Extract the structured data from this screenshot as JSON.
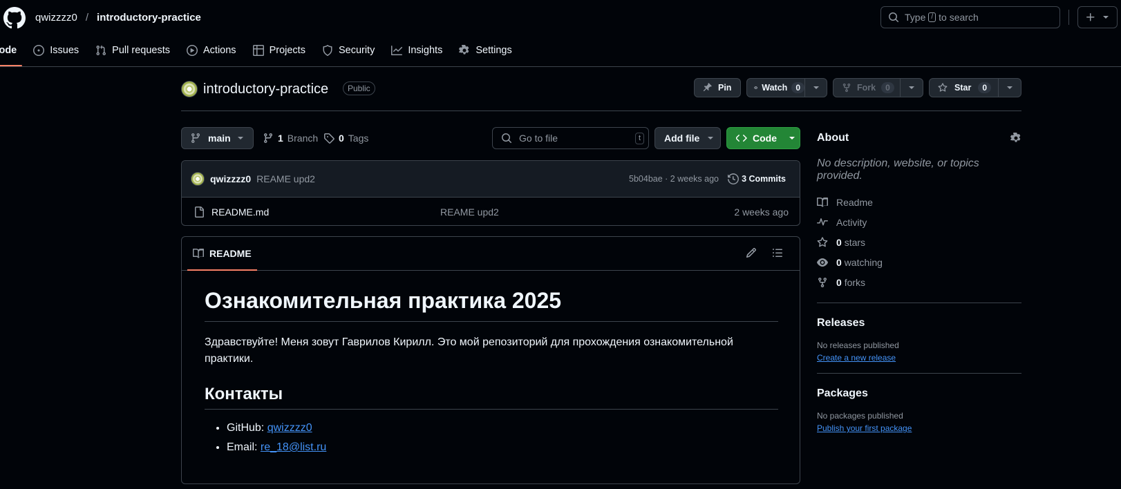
{
  "header": {
    "owner": "qwizzzz0",
    "separator": "/",
    "repo": "introductory-practice",
    "search": {
      "prefix": "Type",
      "key": "/",
      "suffix": "to search"
    }
  },
  "nav": [
    {
      "label": "Code",
      "icon": "code-icon"
    },
    {
      "label": "Issues",
      "icon": "issue-icon"
    },
    {
      "label": "Pull requests",
      "icon": "pull-request-icon"
    },
    {
      "label": "Actions",
      "icon": "play-icon"
    },
    {
      "label": "Projects",
      "icon": "table-icon"
    },
    {
      "label": "Security",
      "icon": "shield-icon"
    },
    {
      "label": "Insights",
      "icon": "graph-icon"
    },
    {
      "label": "Settings",
      "icon": "gear-icon"
    }
  ],
  "repo": {
    "name": "introductory-practice",
    "visibility": "Public",
    "pin": "Pin",
    "watch": {
      "label": "Watch",
      "count": "0"
    },
    "fork": {
      "label": "Fork",
      "count": "0"
    },
    "star": {
      "label": "Star",
      "count": "0"
    }
  },
  "toolbar": {
    "branch": "main",
    "branches_count": "1",
    "branches_label": "Branch",
    "tags_count": "0",
    "tags_label": "Tags",
    "goto_placeholder": "Go to file",
    "goto_key": "t",
    "add_file": "Add file",
    "code": "Code"
  },
  "commit": {
    "author": "qwizzzz0",
    "message": "REAME upd2",
    "meta": "5b04bae · 2 weeks ago",
    "commits": "3 Commits"
  },
  "files": [
    {
      "name": "README.md",
      "message": "REAME upd2",
      "age": "2 weeks ago"
    }
  ],
  "readme": {
    "tab": "README",
    "h1": "Ознакомительная практика 2025",
    "para": "Здравствуйте! Меня зовут Гаврилов Кирилл. Это мой репозиторий для прохождения ознакомительной практики.",
    "h2": "Контакты",
    "items": [
      {
        "label": "GitHub: ",
        "link": "qwizzzz0"
      },
      {
        "label": "Email: ",
        "link": "re_18@list.ru"
      }
    ]
  },
  "about": {
    "title": "About",
    "description": "No description, website, or topics provided.",
    "readme": "Readme",
    "activity": "Activity",
    "stars_count": "0",
    "stars_label": "stars",
    "watching_count": "0",
    "watching_label": "watching",
    "forks_count": "0",
    "forks_label": "forks"
  },
  "releases": {
    "title": "Releases",
    "empty": "No releases published",
    "link": "Create a new release"
  },
  "packages": {
    "title": "Packages",
    "empty": "No packages published",
    "link": "Publish your first package"
  },
  "colors": {
    "background": "#010409",
    "accent_underline": "#f78166",
    "link": "#4493f8",
    "primary_button": "#238636"
  }
}
